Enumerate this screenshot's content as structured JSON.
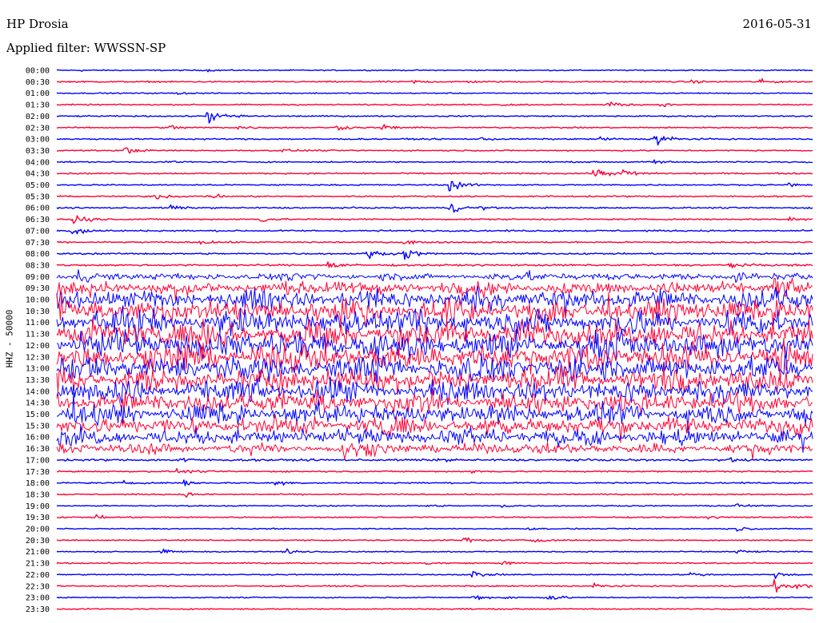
{
  "header": {
    "station": "HP Drosia",
    "date": "2016-05-31",
    "filter": "Applied filter: WWSSN-SP"
  },
  "chart_data": {
    "type": "line",
    "title": "HP Drosia",
    "ylabel": "HHZ - 50000",
    "colors": [
      "#0000ff",
      "#ff0033"
    ],
    "rows": [
      {
        "label": "00:00",
        "activity": 0.04,
        "events": [
          {
            "x": 0.03,
            "amp": 0.1
          },
          {
            "x": 0.2,
            "amp": 0.12
          }
        ]
      },
      {
        "label": "00:30",
        "activity": 0.06,
        "events": [
          {
            "x": 0.47,
            "amp": 0.25
          },
          {
            "x": 0.54,
            "amp": 0.15
          },
          {
            "x": 0.84,
            "amp": 0.2
          },
          {
            "x": 0.93,
            "amp": 0.35
          }
        ]
      },
      {
        "label": "01:00",
        "activity": 0.04,
        "events": [
          {
            "x": 0.16,
            "amp": 0.12
          }
        ]
      },
      {
        "label": "01:30",
        "activity": 0.05,
        "events": [
          {
            "x": 0.59,
            "amp": 0.15
          },
          {
            "x": 0.73,
            "amp": 0.65
          },
          {
            "x": 0.8,
            "amp": 0.25
          }
        ]
      },
      {
        "label": "02:00",
        "activity": 0.05,
        "events": [
          {
            "x": 0.2,
            "amp": 1.2
          },
          {
            "x": 0.24,
            "amp": 0.2
          }
        ]
      },
      {
        "label": "02:30",
        "activity": 0.05,
        "events": [
          {
            "x": 0.15,
            "amp": 0.4
          },
          {
            "x": 0.24,
            "amp": 0.4
          },
          {
            "x": 0.37,
            "amp": 0.4
          },
          {
            "x": 0.43,
            "amp": 0.55
          }
        ]
      },
      {
        "label": "03:00",
        "activity": 0.06,
        "events": [
          {
            "x": 0.56,
            "amp": 0.2
          },
          {
            "x": 0.72,
            "amp": 0.35
          },
          {
            "x": 0.79,
            "amp": 1.8
          }
        ]
      },
      {
        "label": "03:30",
        "activity": 0.05,
        "events": [
          {
            "x": 0.09,
            "amp": 0.6
          },
          {
            "x": 0.3,
            "amp": 0.2
          }
        ]
      },
      {
        "label": "04:00",
        "activity": 0.05,
        "events": [
          {
            "x": 0.15,
            "amp": 0.15
          },
          {
            "x": 0.79,
            "amp": 0.4
          }
        ]
      },
      {
        "label": "04:30",
        "activity": 0.06,
        "events": [
          {
            "x": 0.71,
            "amp": 1.0
          },
          {
            "x": 0.75,
            "amp": 0.7
          }
        ]
      },
      {
        "label": "05:00",
        "activity": 0.05,
        "events": [
          {
            "x": 0.52,
            "amp": 1.2
          },
          {
            "x": 0.97,
            "amp": 0.25
          }
        ]
      },
      {
        "label": "05:30",
        "activity": 0.06,
        "events": [
          {
            "x": 0.13,
            "amp": 0.45
          },
          {
            "x": 0.2,
            "amp": 0.55
          }
        ]
      },
      {
        "label": "06:00",
        "activity": 0.06,
        "events": [
          {
            "x": 0.15,
            "amp": 0.4
          },
          {
            "x": 0.52,
            "amp": 1.0
          },
          {
            "x": 0.56,
            "amp": 0.2
          }
        ]
      },
      {
        "label": "06:30",
        "activity": 0.06,
        "events": [
          {
            "x": 0.02,
            "amp": 1.6
          },
          {
            "x": 0.27,
            "amp": 0.55
          },
          {
            "x": 0.97,
            "amp": 0.3
          }
        ]
      },
      {
        "label": "07:00",
        "activity": 0.07,
        "events": [
          {
            "x": 0.02,
            "amp": 1.2
          }
        ]
      },
      {
        "label": "07:30",
        "activity": 0.06,
        "events": [
          {
            "x": 0.19,
            "amp": 0.35
          },
          {
            "x": 0.46,
            "amp": 0.35
          }
        ]
      },
      {
        "label": "08:00",
        "activity": 0.07,
        "events": [
          {
            "x": 0.41,
            "amp": 0.8
          },
          {
            "x": 0.46,
            "amp": 0.9
          }
        ]
      },
      {
        "label": "08:30",
        "activity": 0.09,
        "events": [
          {
            "x": 0.36,
            "amp": 0.6
          },
          {
            "x": 0.89,
            "amp": 0.5
          }
        ]
      },
      {
        "label": "09:00",
        "activity": 0.45,
        "events": [
          {
            "x": 0.03,
            "amp": 0.9
          },
          {
            "x": 0.62,
            "amp": 0.6
          },
          {
            "x": 0.9,
            "amp": 0.8
          }
        ]
      },
      {
        "label": "09:30",
        "activity": 0.9,
        "events": [
          {
            "x": 0.35,
            "amp": 0.8
          },
          {
            "x": 0.95,
            "amp": 1.5
          }
        ]
      },
      {
        "label": "10:00",
        "activity": 1.4,
        "events": []
      },
      {
        "label": "10:30",
        "activity": 1.6,
        "events": []
      },
      {
        "label": "11:00",
        "activity": 1.7,
        "events": []
      },
      {
        "label": "11:30",
        "activity": 1.8,
        "events": []
      },
      {
        "label": "12:00",
        "activity": 1.8,
        "events": []
      },
      {
        "label": "12:30",
        "activity": 1.8,
        "events": []
      },
      {
        "label": "13:00",
        "activity": 1.7,
        "events": []
      },
      {
        "label": "13:30",
        "activity": 1.6,
        "events": []
      },
      {
        "label": "14:00",
        "activity": 1.5,
        "events": []
      },
      {
        "label": "14:30",
        "activity": 1.4,
        "events": []
      },
      {
        "label": "15:00",
        "activity": 1.3,
        "events": []
      },
      {
        "label": "15:30",
        "activity": 1.2,
        "events": []
      },
      {
        "label": "16:00",
        "activity": 1.1,
        "events": []
      },
      {
        "label": "16:30",
        "activity": 0.7,
        "events": [
          {
            "x": 0.38,
            "amp": 1.0
          }
        ]
      },
      {
        "label": "17:00",
        "activity": 0.1,
        "events": [
          {
            "x": 0.16,
            "amp": 0.5
          },
          {
            "x": 0.5,
            "amp": 0.2
          },
          {
            "x": 0.89,
            "amp": 0.25
          }
        ]
      },
      {
        "label": "17:30",
        "activity": 0.06,
        "events": [
          {
            "x": 0.16,
            "amp": 0.4
          },
          {
            "x": 0.55,
            "amp": 0.2
          }
        ]
      },
      {
        "label": "18:00",
        "activity": 0.06,
        "events": [
          {
            "x": 0.09,
            "amp": 0.25
          },
          {
            "x": 0.17,
            "amp": 0.4
          },
          {
            "x": 0.29,
            "amp": 0.45
          }
        ]
      },
      {
        "label": "18:30",
        "activity": 0.05,
        "events": [
          {
            "x": 0.17,
            "amp": 0.3
          }
        ]
      },
      {
        "label": "19:00",
        "activity": 0.04,
        "events": [
          {
            "x": 0.49,
            "amp": 0.15
          },
          {
            "x": 0.59,
            "amp": 0.2
          },
          {
            "x": 0.9,
            "amp": 0.3
          }
        ]
      },
      {
        "label": "19:30",
        "activity": 0.05,
        "events": [
          {
            "x": 0.05,
            "amp": 0.35
          },
          {
            "x": 0.86,
            "amp": 0.15
          }
        ]
      },
      {
        "label": "20:00",
        "activity": 0.04,
        "events": [
          {
            "x": 0.62,
            "amp": 0.15
          },
          {
            "x": 0.9,
            "amp": 0.35
          }
        ]
      },
      {
        "label": "20:30",
        "activity": 0.05,
        "events": [
          {
            "x": 0.54,
            "amp": 0.4
          },
          {
            "x": 0.63,
            "amp": 0.35
          }
        ]
      },
      {
        "label": "21:00",
        "activity": 0.04,
        "events": [
          {
            "x": 0.14,
            "amp": 0.3
          },
          {
            "x": 0.3,
            "amp": 0.45
          },
          {
            "x": 0.9,
            "amp": 0.35
          }
        ]
      },
      {
        "label": "21:30",
        "activity": 0.05,
        "events": [
          {
            "x": 0.49,
            "amp": 0.2
          },
          {
            "x": 0.59,
            "amp": 0.3
          }
        ]
      },
      {
        "label": "22:00",
        "activity": 0.04,
        "events": [
          {
            "x": 0.55,
            "amp": 0.6
          },
          {
            "x": 0.84,
            "amp": 0.3
          },
          {
            "x": 0.95,
            "amp": 0.5
          }
        ]
      },
      {
        "label": "22:30",
        "activity": 0.05,
        "events": [
          {
            "x": 0.71,
            "amp": 0.4
          },
          {
            "x": 0.95,
            "amp": 1.0
          },
          {
            "x": 0.98,
            "amp": 0.4
          }
        ]
      },
      {
        "label": "23:00",
        "activity": 0.04,
        "events": [
          {
            "x": 0.55,
            "amp": 0.45
          },
          {
            "x": 0.59,
            "amp": 0.3
          },
          {
            "x": 0.65,
            "amp": 0.6
          }
        ]
      },
      {
        "label": "23:30",
        "activity": 0.04,
        "events": [
          {
            "x": 0.52,
            "amp": 0.15
          }
        ]
      }
    ]
  }
}
